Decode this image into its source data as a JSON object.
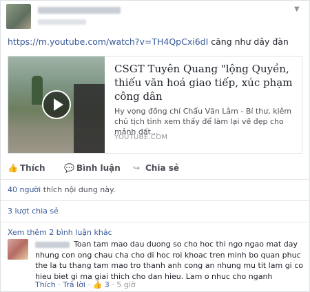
{
  "post": {
    "link_text": "https://m.youtube.com/watch?v=TH4QpCxi6dI",
    "caption": " căng như dây đàn"
  },
  "share": {
    "title": "CSGT Tuyên Quang \"lộng Quyền, thiếu văn hoá giao tiếp, xúc phạm công dân",
    "description": "Hy vọng đồng chí Chẩu Văn Lâm - Bí thư, kiêm chủ tịch tỉnh xem thấy để làm lại về đẹp cho mảnh đất...",
    "domain": "YOUTUBE.COM"
  },
  "actions": {
    "like_label": "Thích",
    "comment_label": "Bình luận",
    "share_label": "Chia sẻ"
  },
  "stats": {
    "likes_count": "40 người",
    "likes_suffix": " thích nội dung này.",
    "shares_text": "3 lượt chia sẻ",
    "more_comments": "Xem thêm 2 bình luận khác"
  },
  "comment": {
    "text": "Toan tam mao dau duong so cho hoc thi ngo ngao mat day nhung con ong chau cha cho di hoc roi khoac tren minh bo quan phuc the la tu thang tam mao tro thanh anh cong an nhung mu tit lam gi co hieu biet gi ma giai thich cho dan hieu. Lam o nhuc cho nganh",
    "like": "Thích",
    "reply": "Trả lời",
    "reaction_count": "3",
    "time": "5 giờ"
  },
  "icons": {
    "chevron": "chevron-down-icon",
    "like": "thumbs-up-icon",
    "comment": "speech-bubble-icon",
    "share": "share-arrow-icon",
    "play": "play-icon"
  },
  "colors": {
    "link": "#365899",
    "muted": "#90949c"
  }
}
